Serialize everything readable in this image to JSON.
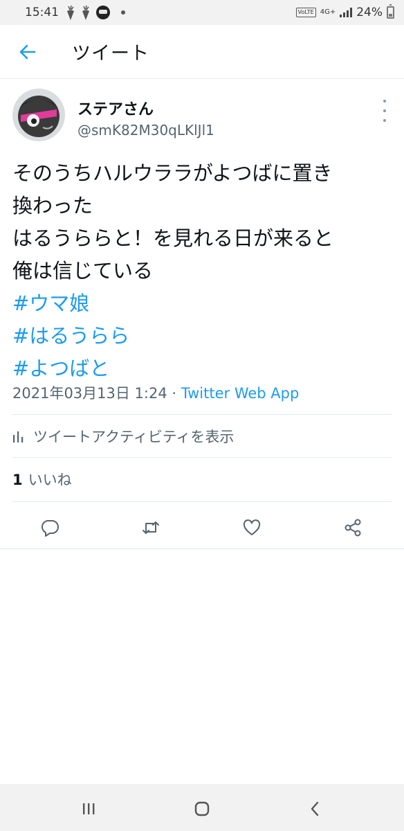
{
  "status_bar": {
    "time": "15:41",
    "network_type": "4G+",
    "volte_label": "VoLTE",
    "battery_percent": "24%"
  },
  "header": {
    "title": "ツイート"
  },
  "tweet": {
    "display_name": "ステアさん",
    "handle": "@smK82M30qLKlJl1",
    "text_lines": [
      "そのうちハルウララがよつばに置き",
      "換わった",
      "はるうららと！を見れる日が来ると",
      "俺は信じている"
    ],
    "hashtags": [
      "#ウマ娘",
      "#はるうらら",
      "#よつばと"
    ],
    "timestamp": "2021年03月13日 1:24",
    "separator": " · ",
    "source": "Twitter Web App",
    "activity_label": "ツイートアクティビティを表示",
    "like_count": "1",
    "like_label": "いいね"
  },
  "colors": {
    "accent": "#1d9bf0",
    "text_primary": "#0f1419",
    "text_secondary": "#536471",
    "divider": "#e1e8ed"
  }
}
